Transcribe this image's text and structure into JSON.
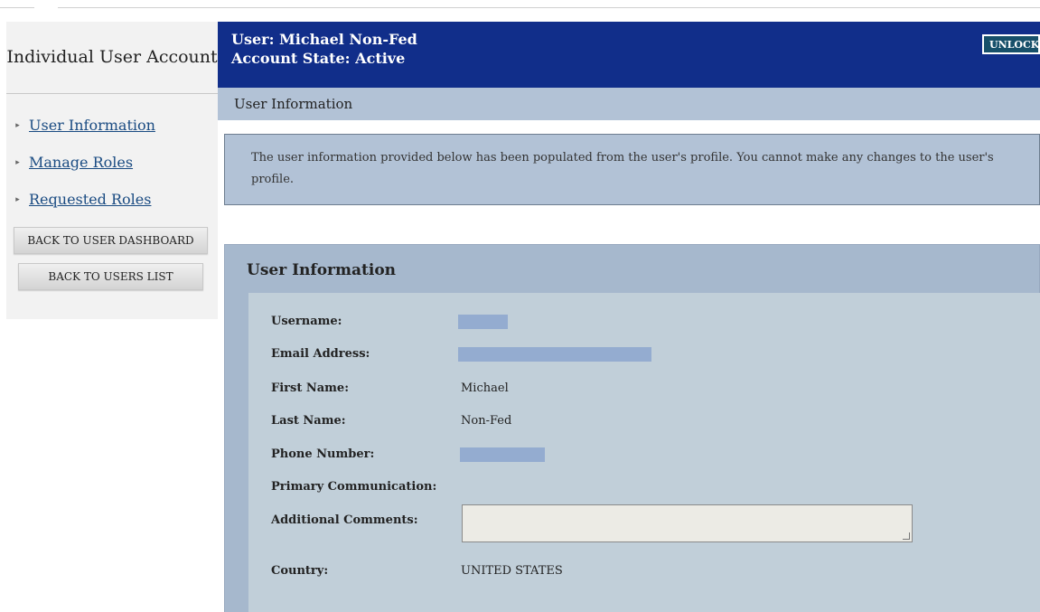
{
  "sidebar": {
    "title": "Individual User Account",
    "items": [
      {
        "label": "User Information"
      },
      {
        "label": "Manage Roles"
      },
      {
        "label": "Requested Roles"
      }
    ],
    "buttons": {
      "dashboard": "BACK TO USER DASHBOARD",
      "users_list": "BACK TO USERS LIST"
    }
  },
  "header": {
    "user_line": "User: Michael Non-Fed",
    "state_line": "Account State: Active",
    "unlock_label": "UNLOCK"
  },
  "section_bar": "User Information",
  "notice": "The user information provided below has been populated from the user's profile. You cannot make any changes to the user's profile.",
  "panel": {
    "title": "User Information",
    "fields": {
      "username": {
        "label": "Username:",
        "value": ""
      },
      "email": {
        "label": "Email Address:",
        "value": ""
      },
      "first_name": {
        "label": "First Name:",
        "value": "Michael"
      },
      "last_name": {
        "label": "Last Name:",
        "value": "Non-Fed"
      },
      "phone": {
        "label": "Phone Number:",
        "value": ""
      },
      "primary_comm": {
        "label": "Primary Communication:",
        "value": ""
      },
      "comments": {
        "label": "Additional Comments:",
        "value": ""
      },
      "country": {
        "label": "Country:",
        "value": "UNITED STATES"
      }
    }
  },
  "colors": {
    "header_bg": "#112e8a",
    "section_bar_bg": "#b2c2d6",
    "panel_bg": "#a6b8cd",
    "panel_inner_bg": "#c1cfd9",
    "link": "#1a4b82",
    "redaction": "#94acd0"
  }
}
